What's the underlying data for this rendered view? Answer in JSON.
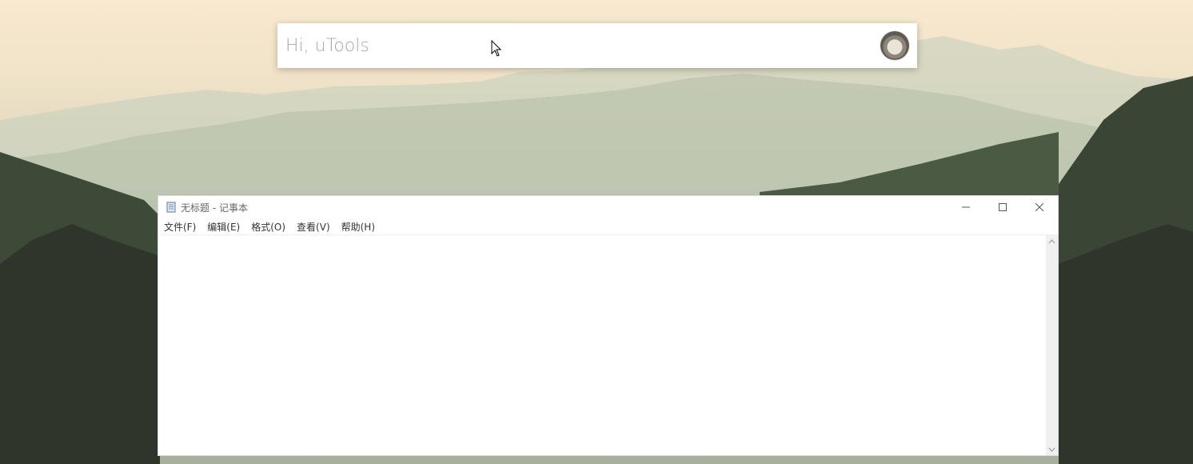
{
  "utools": {
    "placeholder": "Hi, uTools",
    "value": ""
  },
  "notepad": {
    "title": "无标题 - 记事本",
    "menu": [
      "文件(F)",
      "编辑(E)",
      "格式(O)",
      "查看(V)",
      "帮助(H)"
    ],
    "content": ""
  },
  "icons": {
    "avatar": "user-avatar",
    "cursor": "mouse-pointer-icon",
    "app": "notepad-icon",
    "minimize": "minimize-icon",
    "maximize": "maximize-icon",
    "close": "close-icon",
    "scroll_up": "chevron-up-icon",
    "scroll_down": "chevron-down-icon"
  }
}
